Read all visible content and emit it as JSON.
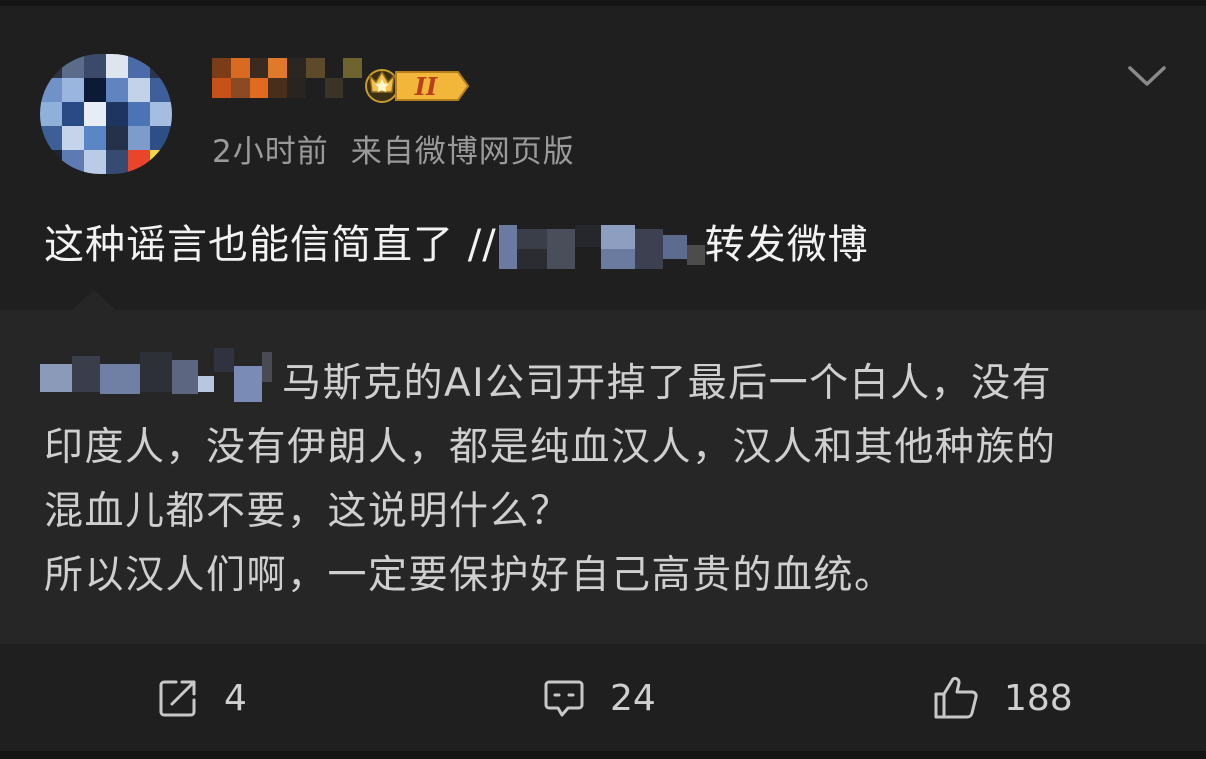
{
  "post": {
    "time_ago": "2小时前",
    "source": "来自微博网页版",
    "text_before": "这种谣言也能信简直了 //",
    "text_after": "转发微博",
    "badge_text": "II"
  },
  "repost": {
    "line1": "马斯克的AI公司开掉了最后一个白人，没有",
    "line2": "印度人，没有伊朗人，都是纯血汉人，汉人和其他种族的",
    "line3": "混血儿都不要，这说明什么？",
    "line4": "所以汉人们啊，一定要保护好自己高贵的血统。"
  },
  "actions": {
    "share_count": "4",
    "comment_count": "24",
    "like_count": "188"
  },
  "colors": {
    "background": "#1f1f1f",
    "repost_background": "#262626",
    "meta_text": "#9a9a9a",
    "badge_gold": "#f0b233"
  },
  "icons": [
    "chevron-down-icon",
    "share-icon",
    "comment-icon",
    "like-icon",
    "crown-icon"
  ]
}
